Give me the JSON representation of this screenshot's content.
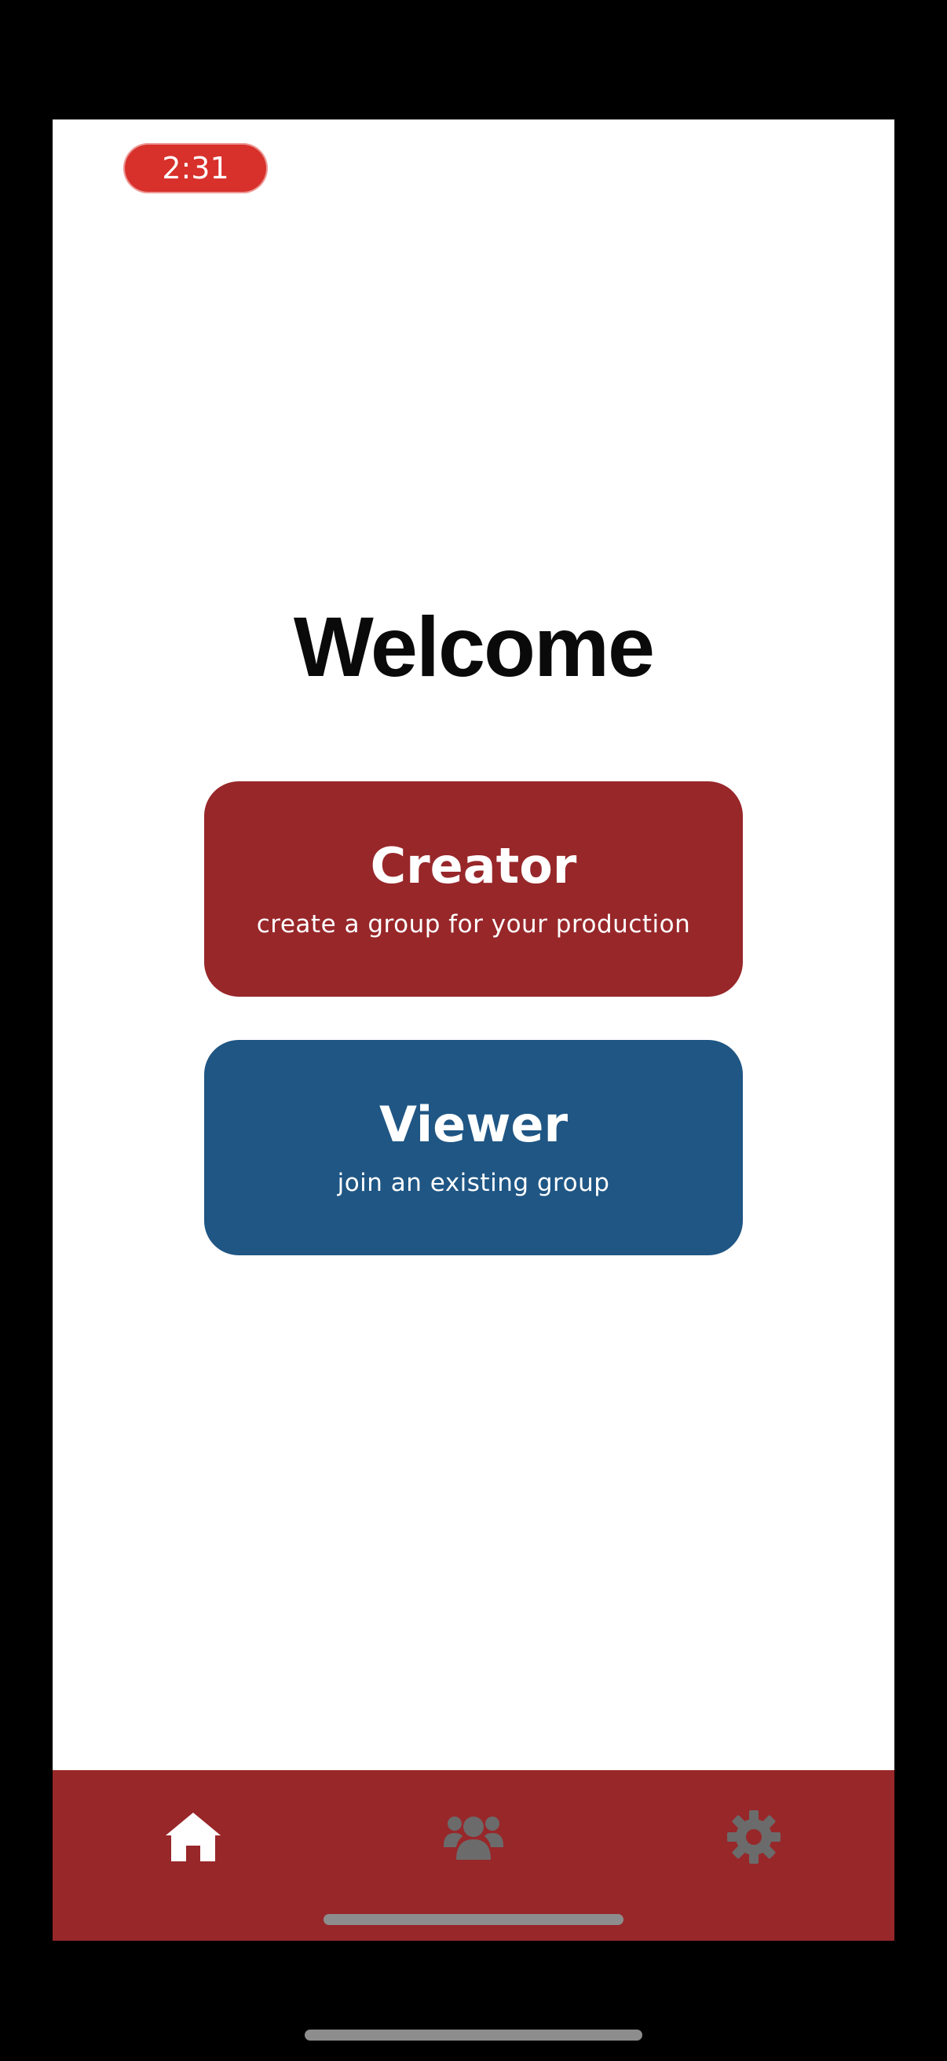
{
  "status_bar": {
    "time": "2:31",
    "pill_color": "#d8302b"
  },
  "main": {
    "title": "Welcome",
    "creator": {
      "title": "Creator",
      "subtitle": "create a group for your production",
      "color": "#98272a"
    },
    "viewer": {
      "title": "Viewer",
      "subtitle": "join an existing group",
      "color": "#1f5684"
    }
  },
  "tab_bar": {
    "color": "#98272a",
    "tabs": [
      {
        "icon": "home-icon",
        "active": true
      },
      {
        "icon": "users-icon",
        "active": false
      },
      {
        "icon": "gear-icon",
        "active": false
      }
    ],
    "active_icon_color": "#ffffff",
    "inactive_icon_color": "#6b6b6b"
  }
}
